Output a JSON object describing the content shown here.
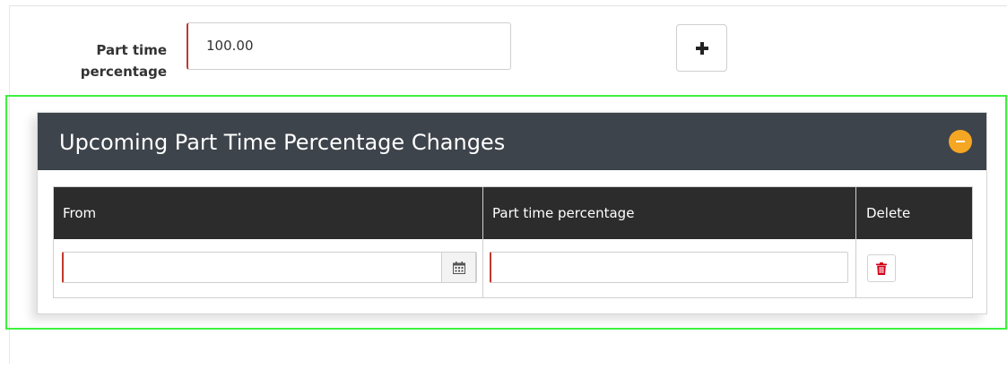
{
  "form": {
    "part_time_label_line1": "Part time",
    "part_time_label_line2": "percentage",
    "part_time_value": "100.00"
  },
  "panel": {
    "title": "Upcoming Part Time Percentage Changes",
    "collapse_icon": "minus-circle-icon",
    "accent_color": "#f5a623",
    "header_color": "#3e444b",
    "table": {
      "columns": [
        "From",
        "Part time percentage",
        "Delete"
      ],
      "rows": [
        {
          "from": "",
          "part_time_percentage": ""
        }
      ]
    }
  },
  "icons": {
    "add": "plus-icon",
    "calendar": "calendar-icon",
    "delete": "trash-icon"
  },
  "colors": {
    "required_border": "#c0392b",
    "delete_icon": "#d0021b",
    "highlight": "#3ef23e"
  }
}
